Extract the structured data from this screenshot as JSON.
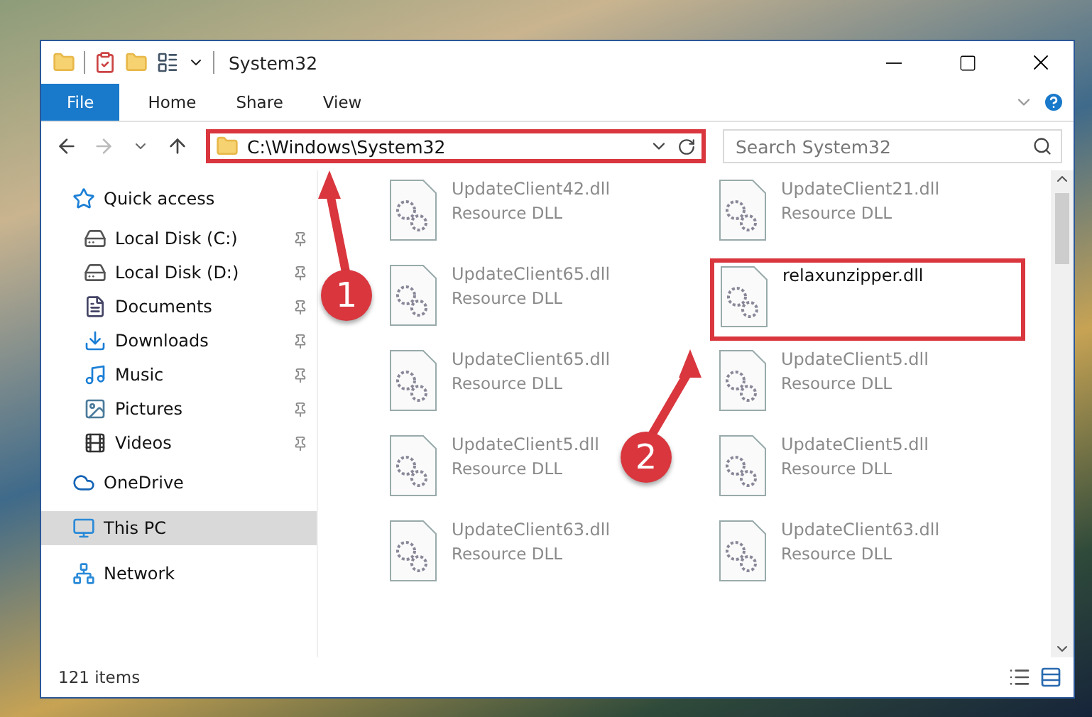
{
  "window": {
    "title": "System32"
  },
  "ribbon": {
    "tabs": [
      {
        "label": "File",
        "selected": true
      },
      {
        "label": "Home",
        "selected": false
      },
      {
        "label": "Share",
        "selected": false
      },
      {
        "label": "View",
        "selected": false
      }
    ]
  },
  "address": {
    "path": "C:\\Windows\\System32",
    "highlighted": true
  },
  "search": {
    "placeholder": "Search System32"
  },
  "nav": {
    "items": [
      {
        "label": "Quick access",
        "kind": "header",
        "pinned": false,
        "selected": false
      },
      {
        "label": "Local Disk (C:)",
        "kind": "item",
        "pinned": true,
        "selected": false
      },
      {
        "label": "Local Disk (D:)",
        "kind": "item",
        "pinned": true,
        "selected": false
      },
      {
        "label": "Documents",
        "kind": "item",
        "pinned": true,
        "selected": false
      },
      {
        "label": "Downloads",
        "kind": "item",
        "pinned": true,
        "selected": false
      },
      {
        "label": "Music",
        "kind": "item",
        "pinned": true,
        "selected": false
      },
      {
        "label": "Pictures",
        "kind": "item",
        "pinned": true,
        "selected": false
      },
      {
        "label": "Videos",
        "kind": "item",
        "pinned": true,
        "selected": false
      },
      {
        "label": "OneDrive",
        "kind": "header",
        "pinned": false,
        "selected": false
      },
      {
        "label": "This PC",
        "kind": "header",
        "pinned": false,
        "selected": true
      },
      {
        "label": "Network",
        "kind": "header",
        "pinned": false,
        "selected": false
      }
    ]
  },
  "files": [
    {
      "name": "UpdateClient42.dll",
      "type": "Resource DLL",
      "faded": true,
      "highlighted": false
    },
    {
      "name": "UpdateClient21.dll",
      "type": "Resource DLL",
      "faded": true,
      "highlighted": false
    },
    {
      "name": "UpdateClient65.dll",
      "type": "Resource DLL",
      "faded": true,
      "highlighted": false
    },
    {
      "name": "relaxunzipper.dll",
      "faded": false,
      "highlighted": true
    },
    {
      "name": "UpdateClient65.dll",
      "type": "Resource DLL",
      "faded": true,
      "highlighted": false
    },
    {
      "name": "UpdateClient5.dll",
      "type": "Resource DLL",
      "faded": true,
      "highlighted": false
    },
    {
      "name": "UpdateClient5.dll",
      "type": "Resource DLL",
      "faded": true,
      "highlighted": false
    },
    {
      "name": "UpdateClient5.dll",
      "type": "Resource DLL",
      "faded": true,
      "highlighted": false
    },
    {
      "name": "UpdateClient63.dll",
      "type": "Resource DLL",
      "faded": true,
      "highlighted": false
    },
    {
      "name": "UpdateClient63.dll",
      "type": "Resource DLL",
      "faded": true,
      "highlighted": false
    }
  ],
  "annotations": [
    {
      "label": "1"
    },
    {
      "label": "2"
    }
  ],
  "status_bar": {
    "count": "121 items"
  }
}
